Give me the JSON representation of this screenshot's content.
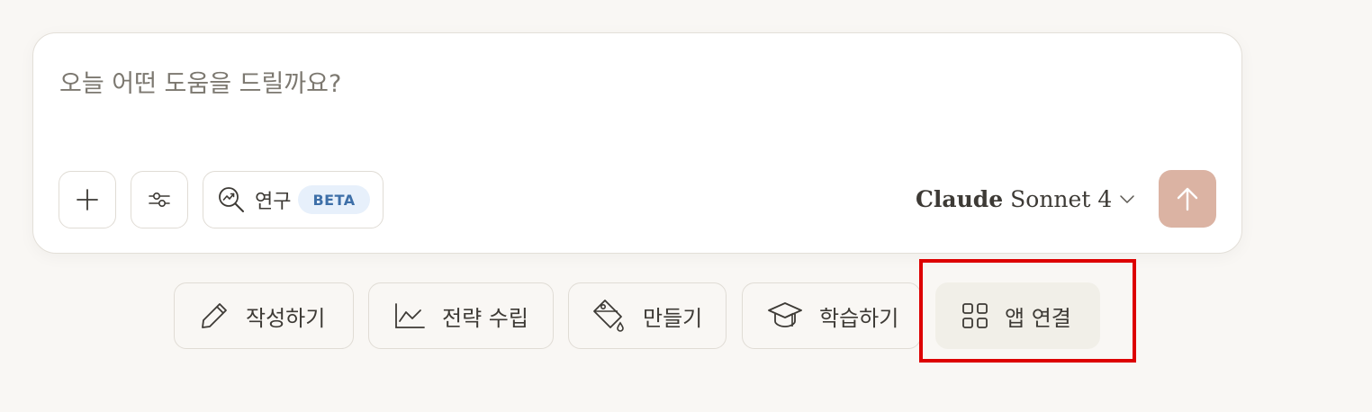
{
  "composer": {
    "placeholder": "오늘 어떤 도움을 드릴까요?",
    "value": ""
  },
  "toolbar": {
    "add_icon": "plus-icon",
    "tools_icon": "sliders-icon",
    "research": {
      "icon": "research-magnifier-icon",
      "label": "연구",
      "badge": "BETA"
    }
  },
  "model_selector": {
    "brand": "Claude",
    "model": "Sonnet 4",
    "icon": "chevron-down-icon"
  },
  "send_button": {
    "icon": "arrow-up-icon",
    "color": "#dbb3a3"
  },
  "suggestions": [
    {
      "label": "작성하기",
      "icon": "pencil-icon"
    },
    {
      "label": "전략 수립",
      "icon": "line-chart-icon"
    },
    {
      "label": "만들기",
      "icon": "paint-bucket-icon"
    },
    {
      "label": "학습하기",
      "icon": "graduation-cap-icon"
    },
    {
      "label": "앱 연결",
      "icon": "grid-icon"
    }
  ],
  "highlight": {
    "color": "#dd0000",
    "target": "앱 연결"
  }
}
